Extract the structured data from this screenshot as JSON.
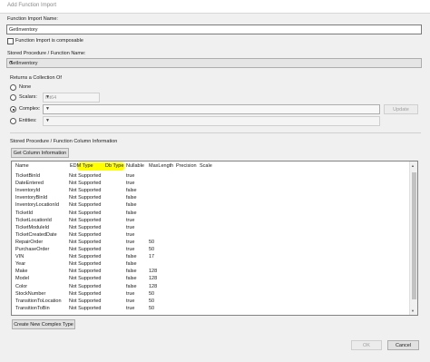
{
  "window": {
    "title": "Add Function Import"
  },
  "function_import_name": {
    "label": "Function Import Name:",
    "value": "GetInventory"
  },
  "composable": {
    "label": "Function Import is composable",
    "checked": false
  },
  "stored_procedure": {
    "label": "Stored Procedure / Function Name:",
    "value": "GetInventory"
  },
  "returns": {
    "label": "Returns a Collection Of",
    "none_label": "None",
    "scalars_label": "Scalars:",
    "scalars_value": "Int64",
    "complex_label": "Complex:",
    "complex_value": "",
    "update_label": "Update",
    "entities_label": "Entities:",
    "entities_value": "",
    "selected": "complex"
  },
  "column_info": {
    "label": "Stored Procedure / Function Column Information",
    "get_button": "Get Column Information",
    "headers": [
      "Name",
      "EDM Type",
      "Db Type",
      "Nullable",
      "MaxLength",
      "Precision",
      "Scale"
    ],
    "rows": [
      [
        "TicketBinId",
        "Not Supported",
        "",
        "true",
        ""
      ],
      [
        "DateEntered",
        "Not Supported",
        "",
        "true",
        ""
      ],
      [
        "InventoryId",
        "Not Supported",
        "",
        "false",
        ""
      ],
      [
        "InventoryBinId",
        "Not Supported",
        "",
        "false",
        ""
      ],
      [
        "InventoryLocationId",
        "Not Supported",
        "",
        "false",
        ""
      ],
      [
        "TicketId",
        "Not Supported",
        "",
        "false",
        ""
      ],
      [
        "TicketLocationId",
        "Not Supported",
        "",
        "true",
        ""
      ],
      [
        "TicketModuleId",
        "Not Supported",
        "",
        "true",
        ""
      ],
      [
        "TicketCreatedDate",
        "Not Supported",
        "",
        "true",
        ""
      ],
      [
        "RepairOrder",
        "Not Supported",
        "",
        "true",
        "50"
      ],
      [
        "PurchaseOrder",
        "Not Supported",
        "",
        "true",
        "50"
      ],
      [
        "VIN",
        "Not Supported",
        "",
        "false",
        "17"
      ],
      [
        "Year",
        "Not Supported",
        "",
        "false",
        ""
      ],
      [
        "Make",
        "Not Supported",
        "",
        "false",
        "128"
      ],
      [
        "Model",
        "Not Supported",
        "",
        "false",
        "128"
      ],
      [
        "Color",
        "Not Supported",
        "",
        "false",
        "128"
      ],
      [
        "StockNumber",
        "Not Supported",
        "",
        "true",
        "50"
      ],
      [
        "TransitionToLocation",
        "Not Supported",
        "",
        "true",
        "50"
      ],
      [
        "TransitionToBin",
        "Not Supported",
        "",
        "true",
        "50"
      ]
    ]
  },
  "create_complex_button": "Create New Complex Type",
  "ok_button": "OK",
  "cancel_button": "Cancel",
  "colors": {
    "highlight": "#ffff00",
    "background": "#f0f0f0"
  }
}
